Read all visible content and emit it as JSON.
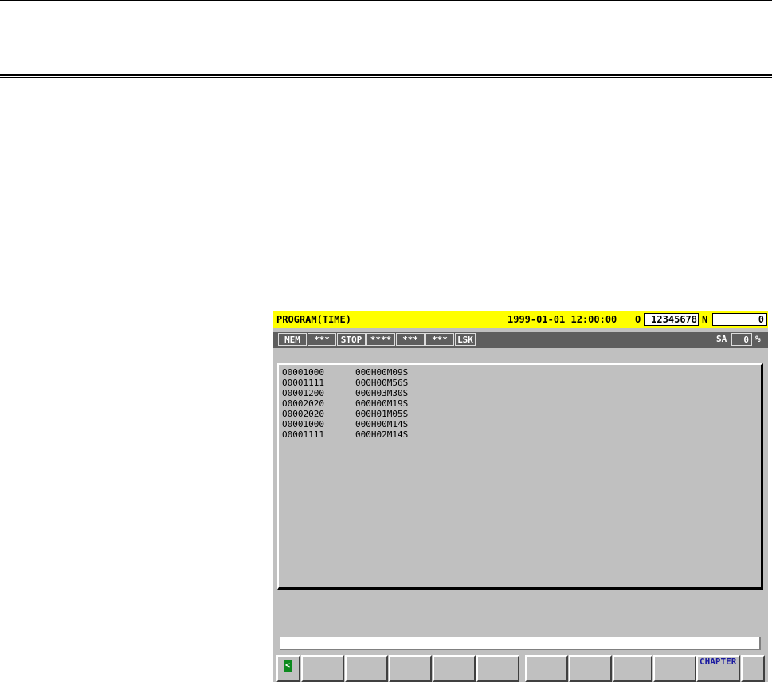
{
  "screen": {
    "title": "PROGRAM(TIME)",
    "datetime": "1999-01-01 12:00:00",
    "o_label": "O",
    "o_value": "12345678",
    "n_label": "N",
    "n_value": "0"
  },
  "status": {
    "cells": [
      "MEM",
      "***",
      "STOP",
      "****",
      "***",
      "***",
      "LSK"
    ],
    "sa_label": "SA",
    "sa_value": "0",
    "sa_unit": "%"
  },
  "programs": [
    {
      "number": "O0001000",
      "time": "000H00M09S"
    },
    {
      "number": "O0001111",
      "time": "000H00M56S"
    },
    {
      "number": "O0001200",
      "time": "000H03M30S"
    },
    {
      "number": "O0002020",
      "time": "000H00M19S"
    },
    {
      "number": "O0002020",
      "time": "000H01M05S"
    },
    {
      "number": "O0001000",
      "time": "000H00M14S"
    },
    {
      "number": "O0001111",
      "time": "000H02M14S"
    }
  ],
  "softkeys": {
    "left_arrow_icon": "left-arrow-icon",
    "labels": [
      "",
      "",
      "",
      "",
      "",
      "",
      "",
      "",
      "",
      "CHAPTER",
      ""
    ]
  },
  "colors": {
    "title_bg": "#ffff00",
    "status_bg": "#5e5e5e",
    "screen_bg": "#c0c0c0",
    "arrow_green": "#0c8a1e",
    "softkey_text": "#1a1aa0"
  }
}
